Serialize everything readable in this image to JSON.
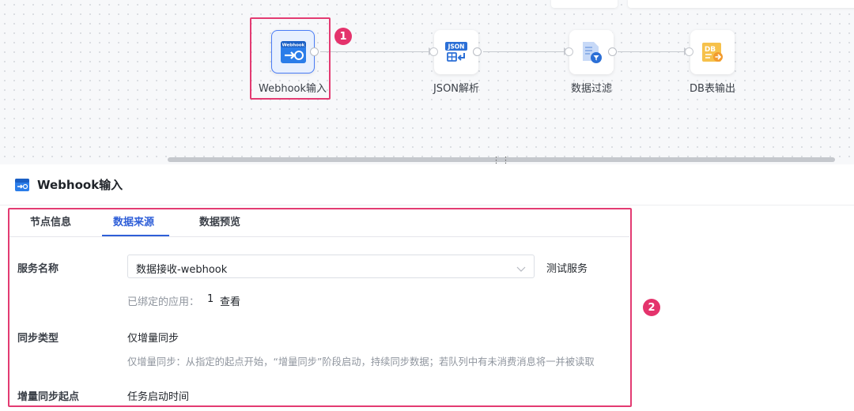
{
  "canvas": {
    "nodes": [
      {
        "label": "Webhook输入",
        "icon": "webhook-icon",
        "selected": true
      },
      {
        "label": "JSON解析",
        "icon": "json-parse-icon",
        "selected": false
      },
      {
        "label": "数据过滤",
        "icon": "data-filter-icon",
        "selected": false
      },
      {
        "label": "DB表输出",
        "icon": "db-output-icon",
        "selected": false
      }
    ],
    "callout_1": "1",
    "drag_handle": "⋮⋮"
  },
  "panel": {
    "title": "Webhook输入",
    "tabs": [
      {
        "label": "节点信息"
      },
      {
        "label": "数据来源"
      },
      {
        "label": "数据预览"
      }
    ],
    "active_tab": "数据来源",
    "service": {
      "label": "服务名称",
      "value": "数据接收-webhook",
      "test_label": "测试服务",
      "bound_prefix": "已绑定的应用：",
      "bound_count": "1",
      "view_label": "查看"
    },
    "sync_type": {
      "label": "同步类型",
      "value": "仅增量同步",
      "description": "仅增量同步：从指定的起点开始，“增量同步”阶段启动，持续同步数据；若队列中有未消费消息将一并被读取"
    },
    "sync_start": {
      "label": "增量同步起点",
      "value": "任务启动时间"
    },
    "callout_2": "2"
  },
  "colors": {
    "accent": "#2f5fd8",
    "highlight": "#e33b72",
    "canvas_bg": "#f7f8fa"
  }
}
